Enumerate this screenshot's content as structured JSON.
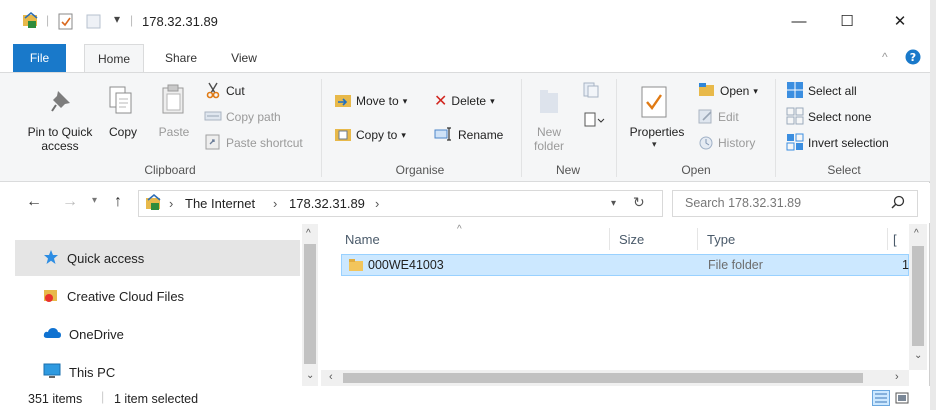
{
  "window": {
    "title": "178.32.31.89",
    "controls": {
      "minimize": "—",
      "maximize": "☐",
      "close": "✕"
    }
  },
  "ribbon_tabs": [
    "File",
    "Home",
    "Share",
    "View"
  ],
  "ribbon": {
    "clipboard": {
      "label": "Clipboard",
      "pin_label_1": "Pin to Quick",
      "pin_label_2": "access",
      "copy": "Copy",
      "paste": "Paste",
      "cut": "Cut",
      "copy_path": "Copy path",
      "paste_shortcut": "Paste shortcut"
    },
    "organise": {
      "label": "Organise",
      "move_to": "Move to",
      "copy_to": "Copy to",
      "delete": "Delete",
      "rename": "Rename"
    },
    "new": {
      "label": "New",
      "new_folder_1": "New",
      "new_folder_2": "folder"
    },
    "open": {
      "label": "Open",
      "properties": "Properties",
      "open": "Open",
      "edit": "Edit",
      "history": "History"
    },
    "select": {
      "label": "Select",
      "select_all": "Select all",
      "select_none": "Select none",
      "invert_selection": "Invert selection"
    }
  },
  "address": {
    "crumbs": [
      "The Internet",
      "178.32.31.89"
    ],
    "search_placeholder": "Search 178.32.31.89"
  },
  "nav_pane": [
    {
      "label": "Quick access",
      "icon": "star-icon"
    },
    {
      "label": "Creative Cloud Files",
      "icon": "creative-cloud-icon"
    },
    {
      "label": "OneDrive",
      "icon": "cloud-icon"
    },
    {
      "label": "This PC",
      "icon": "monitor-icon"
    }
  ],
  "columns": {
    "name": "Name",
    "size": "Size",
    "type": "Type",
    "extra": "["
  },
  "files": [
    {
      "name": "000WE41003",
      "size": "",
      "type": "File folder",
      "extra": "1"
    }
  ],
  "status": {
    "items": "351 items",
    "selected": "1 item selected"
  },
  "colors": {
    "accent": "#1979ca",
    "selection": "#cce8ff",
    "selection_border": "#99d1ff",
    "folder": "#f2c55c"
  }
}
